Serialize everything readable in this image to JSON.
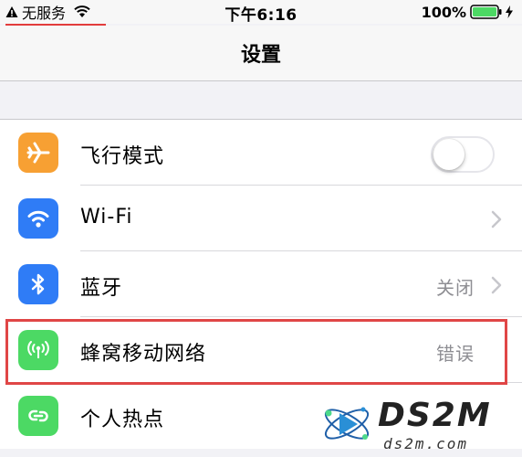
{
  "status_bar": {
    "carrier": "无服务",
    "time": "下午6:16",
    "battery_percent": "100%",
    "battery_level": 1.0,
    "warning_icon": "warning-triangle-icon",
    "wifi_icon": "wifi-icon",
    "charging_icon": "bolt-icon"
  },
  "nav": {
    "title": "设置"
  },
  "settings": {
    "items": [
      {
        "label": "飞行模式",
        "icon": "airplane-icon",
        "icon_color": "#f7a033",
        "control": "toggle",
        "toggle_on": false
      },
      {
        "label": "Wi-Fi",
        "icon": "wifi-icon",
        "icon_color": "#2f7cf6",
        "control": "chevron"
      },
      {
        "label": "蓝牙",
        "icon": "bluetooth-icon",
        "icon_color": "#2f7cf6",
        "value": "关闭",
        "control": "chevron"
      },
      {
        "label": "蜂窝移动网络",
        "icon": "antenna-icon",
        "icon_color": "#4cd964",
        "value": "错误",
        "control": "none",
        "highlighted": true
      },
      {
        "label": "个人热点",
        "icon": "link-icon",
        "icon_color": "#4cd964"
      }
    ]
  },
  "colors": {
    "highlight": "#e04646",
    "background": "#f2f2f6",
    "secondary_text": "#8e8e93"
  },
  "watermark": {
    "main": "DS2M",
    "sub": "ds2m.com"
  }
}
